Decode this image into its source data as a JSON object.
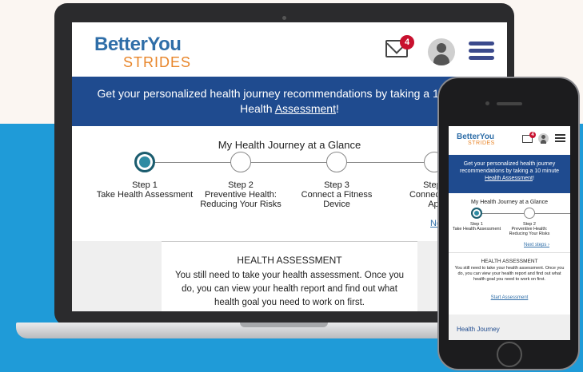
{
  "brand": {
    "name_top": "BetterYou",
    "name_bottom": "STRIDES"
  },
  "header": {
    "notification_count": "4"
  },
  "banner": {
    "text_before": "Get your personalized health journey recommendations by taking a 10 minute Health ",
    "link_text": "Assessment",
    "text_after": "!",
    "mobile_text_before": "Get your personalized health journey recommendations by taking a 10 minute ",
    "mobile_link_text": "Health Assessment",
    "mobile_text_after": "!"
  },
  "journey": {
    "title": "My Health Journey at a Glance",
    "steps": [
      {
        "label": "Step 1\nTake Health Assessment"
      },
      {
        "label": "Step 2\nPreventive Health:\nReducing Your Risks"
      },
      {
        "label": "Step 3\nConnect a Fitness\nDevice"
      },
      {
        "label": "Step 4\nConnect Your\nApp"
      }
    ],
    "next_steps": "Next steps",
    "next_steps_mobile": "Next steps ›"
  },
  "assessment": {
    "title": "HEALTH ASSESSMENT",
    "body": "You still need to take your health assessment. Once you do, you can view your health report and find out what health goal you need to work on first.",
    "start_link": "Start Assessment"
  },
  "mobile": {
    "journey_section": "Health Journey"
  },
  "colors": {
    "primary_blue": "#1f4b8f",
    "accent_orange": "#e8862b",
    "badge_red": "#c8102e",
    "background_blue": "#1f9bd8"
  }
}
